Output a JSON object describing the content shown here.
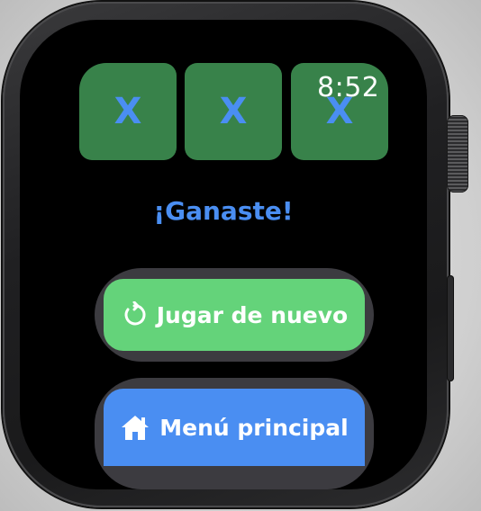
{
  "board": {
    "cells": [
      "X",
      "X",
      "X"
    ]
  },
  "status": {
    "time": "8:52"
  },
  "result": {
    "message": "¡Ganaste!"
  },
  "buttons": {
    "play_again": "Jugar de nuevo",
    "main_menu": "Menú principal"
  },
  "icons": {
    "play_again": "restart-icon",
    "main_menu": "home-icon"
  },
  "colors": {
    "tile": "#38824a",
    "accent_blue": "#4a8ef2",
    "play_again_button": "#64d37a",
    "main_menu_button": "#4a8ef2",
    "button_outline": "#3c3b40"
  }
}
